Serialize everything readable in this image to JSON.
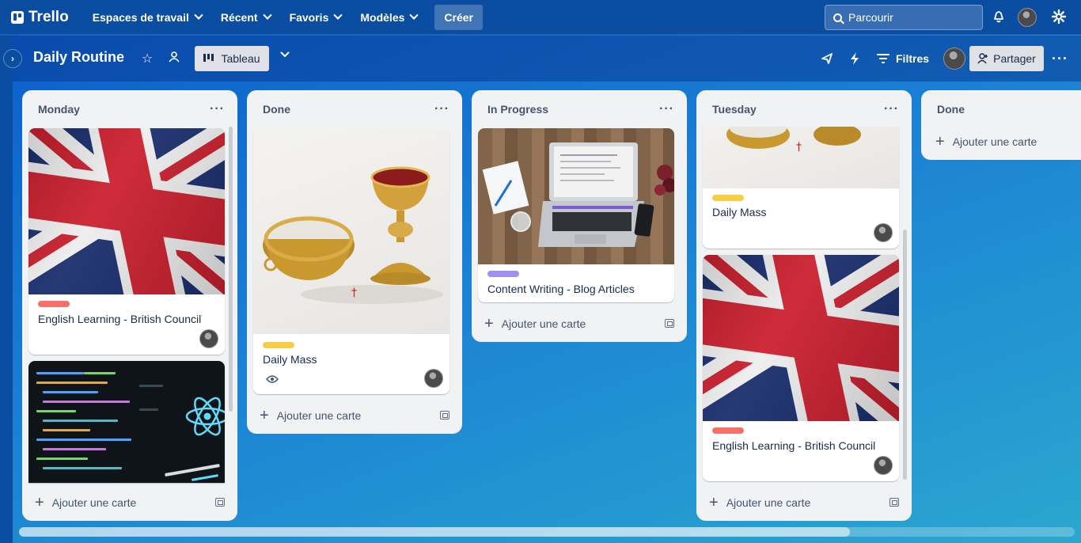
{
  "topnav": {
    "logo_text": "Trello",
    "items": [
      {
        "label": "Espaces de travail"
      },
      {
        "label": "Récent"
      },
      {
        "label": "Favoris"
      },
      {
        "label": "Modèles"
      }
    ],
    "create_label": "Créer",
    "search_placeholder": "Parcourir",
    "icons": [
      "bell-icon",
      "avatar",
      "gear-icon"
    ]
  },
  "board": {
    "title": "Daily Routine",
    "view_label": "Tableau",
    "filters_label": "Filtres",
    "share_label": "Partager",
    "icons": [
      "star-icon",
      "workspace-visibility-icon",
      "board-view-icon",
      "chevron-down-icon",
      "power-ups-icon",
      "automation-icon",
      "filter-icon",
      "more-icon"
    ]
  },
  "lists": [
    {
      "name": "Monday",
      "cards": [
        {
          "title": "English Learning - British Council",
          "label_color": "#f87168",
          "cover": "uk-flag"
        },
        {
          "title": "",
          "cover": "code-screenshot"
        }
      ],
      "add_label": "Ajouter une carte"
    },
    {
      "name": "Done",
      "cards": [
        {
          "title": "Daily Mass",
          "label_color": "#f5cd47",
          "cover": "chalice-and-ciborium",
          "watching": true
        }
      ],
      "add_label": "Ajouter une carte"
    },
    {
      "name": "In Progress",
      "cards": [
        {
          "title": "Content Writing - Blog Articles",
          "label_color": "#9f8fef",
          "cover": "laptop-on-desk"
        }
      ],
      "add_label": "Ajouter une carte"
    },
    {
      "name": "Tuesday",
      "cards": [
        {
          "title": "Daily Mass",
          "label_color": "#f5cd47",
          "cover": "chalice-and-ciborium"
        },
        {
          "title": "English Learning - British Council",
          "label_color": "#f87168",
          "cover": "uk-flag"
        }
      ],
      "add_label": "Ajouter une carte"
    },
    {
      "name": "Done",
      "cards": [],
      "add_label": "Ajouter une carte"
    }
  ]
}
